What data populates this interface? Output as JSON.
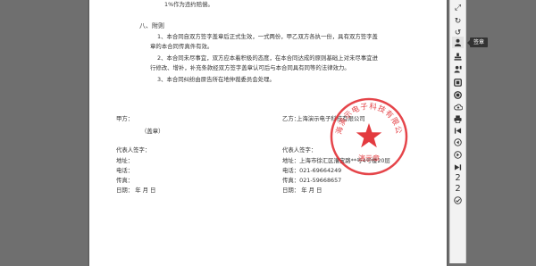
{
  "document": {
    "top_line": "1%作为违约赔偿。",
    "section_heading": "八、附则",
    "clause1_line1": "1、本合同自双方签字盖章后正式生效，一式两份，甲乙双方各执一份，具有双方签字盖",
    "clause1_line2": "章的本合同传真件有效。",
    "clause2_line1": "2、本合同未尽事宜，双方应本着积极的态度，在本合同达成的原则基础上对未尽事宜进",
    "clause2_line2": "行修改、增补，补充条款经双方签字盖章认可后与本合同具有同等的法律效力。",
    "clause3": "3、本合同纠纷由原告所在地仲裁委员会处理。",
    "party_a": {
      "label": "甲方：",
      "seal_note": "（盖章）",
      "rep": "代表人签字：",
      "address": "地址：",
      "phone": "电话：",
      "fax": "传真：",
      "date": "日期：          年      月      日"
    },
    "party_b": {
      "label": "乙方：",
      "company": "上海演示电子科技有限公司",
      "rep": "代表人签字：",
      "address": "地址：上海市徐汇区漕宝路**号4号楼20层",
      "phone": "电话：021-69664249",
      "fax": "传真：021-59668657",
      "date": "日期：          年      月      日"
    },
    "seal_text_top": "上海演示电子科技有限公司",
    "seal_text_bottom": "演示章",
    "seal_color": "#e0252a"
  },
  "toolbar": {
    "buttons": [
      {
        "name": "expand-icon",
        "glyph": "⤢"
      },
      {
        "name": "rotate-icon",
        "glyph": "↻"
      },
      {
        "name": "undo-icon",
        "glyph": "↺"
      },
      {
        "name": "user-sign-icon",
        "glyph": "👤",
        "active": true
      },
      {
        "name": "stamp-icon",
        "glyph": "⛉"
      },
      {
        "name": "person-stamp-icon",
        "glyph": "♙"
      },
      {
        "name": "seal-icon",
        "glyph": "▣"
      },
      {
        "name": "date-seal-icon",
        "glyph": "◙"
      },
      {
        "name": "cloud-icon",
        "glyph": "☁"
      },
      {
        "name": "print-icon",
        "glyph": "⎙"
      },
      {
        "name": "first-page-icon",
        "glyph": "⏮"
      },
      {
        "name": "prev-page-icon",
        "glyph": "◀"
      },
      {
        "name": "next-page-icon",
        "glyph": "▶"
      },
      {
        "name": "last-page-icon",
        "glyph": "⏭"
      }
    ],
    "current_page": "2",
    "total_pages": "2",
    "confirm_glyph": "✔",
    "tooltip": "签章"
  }
}
